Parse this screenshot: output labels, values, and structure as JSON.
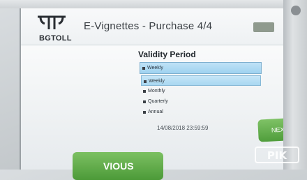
{
  "header": {
    "brand": "BGTOLL",
    "title": "E-Vignettes - Purchase 4/4"
  },
  "validity": {
    "heading": "Validity Period",
    "selected_value": "Weekly",
    "options": [
      "Weekly",
      "Monthly",
      "Quarterly",
      "Annual"
    ],
    "highlighted_index": 0
  },
  "datetime": "14/08/2018 23:59:59",
  "buttons": {
    "next": "NEXT",
    "previous": "VIOUS"
  },
  "watermark": "PIK",
  "colors": {
    "primary_green": "#5aa944",
    "select_blue": "#a8d7f1"
  }
}
